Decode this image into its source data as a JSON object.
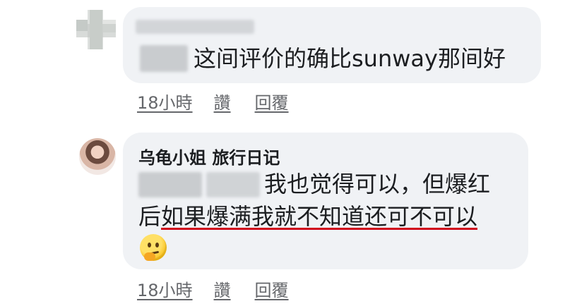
{
  "comments": [
    {
      "author": "",
      "text": "这间评价的确比sunway那间好",
      "time": "18小時",
      "like": "讚",
      "reply": "回覆"
    },
    {
      "author": "乌龟小姐 旅行日记",
      "text_line1": "我也觉得可以，但爆红",
      "text_line2_prefix": "后",
      "text_line2_underlined": "如果爆满我就不知道还可不可以",
      "emoji": "thinking-face-icon",
      "time": "18小時",
      "like": "讚",
      "reply": "回覆"
    }
  ],
  "colors": {
    "bubble": "#f0f2f5",
    "underline": "#d0021b",
    "meta": "#65676b"
  }
}
